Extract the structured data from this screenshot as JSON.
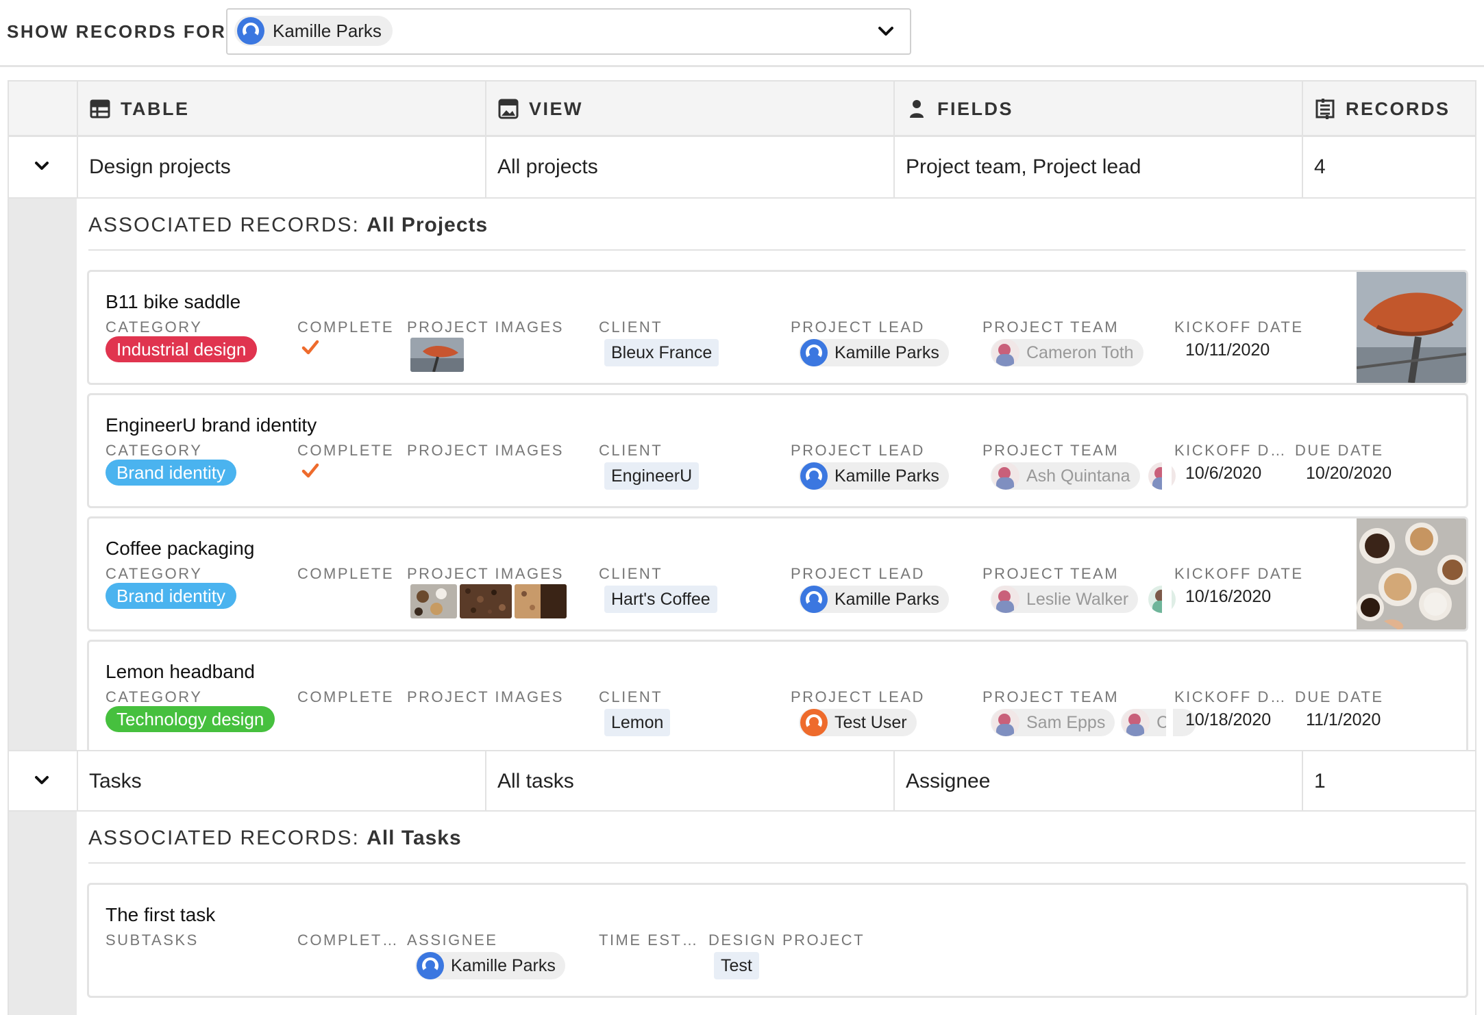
{
  "filter": {
    "label": "SHOW RECORDS FOR:",
    "selected_user": "Kamille Parks"
  },
  "columns": {
    "table": "TABLE",
    "view": "VIEW",
    "fields": "FIELDS",
    "records": "RECORDS"
  },
  "rows": [
    {
      "table": "Design projects",
      "view": "All projects",
      "fields": "Project team, Project lead",
      "records": "4",
      "assoc_prefix": "ASSOCIATED RECORDS: ",
      "assoc_view": "All Projects"
    },
    {
      "table": "Tasks",
      "view": "All tasks",
      "fields": "Assignee",
      "records": "1",
      "assoc_prefix": "ASSOCIATED RECORDS: ",
      "assoc_view": "All Tasks"
    }
  ],
  "field_labels": {
    "category": "CATEGORY",
    "complete": "COMPLETE",
    "project_images": "PROJECT IMAGES",
    "client": "CLIENT",
    "project_lead": "PROJECT LEAD",
    "project_team": "PROJECT TEAM",
    "kickoff_date": "KICKOFF DATE",
    "kickoff_date_short": "KICKOFF D…",
    "due_date": "DUE DATE",
    "subtasks": "SUBTASKS",
    "complete_short": "COMPLET…",
    "assignee": "ASSIGNEE",
    "time_est": "TIME EST…",
    "design_project": "DESIGN PROJECT"
  },
  "projects": [
    {
      "name": "B11 bike saddle",
      "category": "Industrial design",
      "category_color": "#e0344f",
      "complete": true,
      "client": "Bleux France",
      "project_lead": "Kamille Parks",
      "project_team": "Cameron Toth",
      "kickoff_date": "10/11/2020"
    },
    {
      "name": "EngineerU brand identity",
      "category": "Brand identity",
      "category_color": "#4ab3ef",
      "complete": true,
      "client": "EngineerU",
      "project_lead": "Kamille Parks",
      "project_team": "Ash Quintana",
      "kickoff_date": "10/6/2020",
      "due_date": "10/20/2020"
    },
    {
      "name": "Coffee packaging",
      "category": "Brand identity",
      "category_color": "#4ab3ef",
      "complete": false,
      "client": "Hart's Coffee",
      "project_lead": "Kamille Parks",
      "project_team": "Leslie Walker",
      "kickoff_date": "10/16/2020"
    },
    {
      "name": "Lemon headband",
      "category": "Technology design",
      "category_color": "#46c03e",
      "complete": false,
      "client": "Lemon",
      "project_lead": "Test User",
      "project_team": "Sam Epps",
      "project_team_2": "C",
      "kickoff_date": "10/18/2020",
      "due_date": "11/1/2020"
    }
  ],
  "tasks": [
    {
      "name": "The first task",
      "assignee": "Kamille Parks",
      "design_project": "Test"
    }
  ],
  "colors": {
    "check": "#ee6b2c",
    "header_bg": "#f4f4f4",
    "gutter": "#e9e9e9"
  },
  "icons": [
    "person-icon",
    "chevron-down-icon",
    "table-icon",
    "view-icon",
    "records-icon",
    "checkmark-icon"
  ]
}
